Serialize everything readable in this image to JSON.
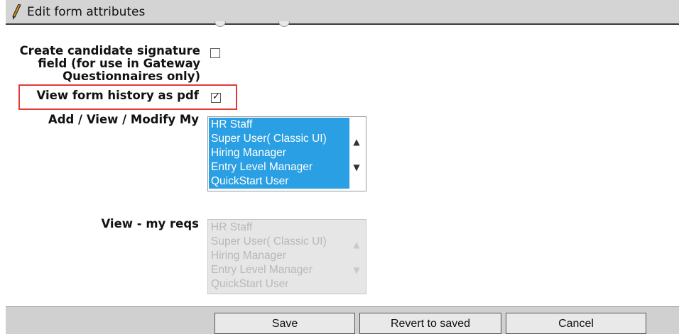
{
  "header": {
    "title": "Edit form attributes",
    "icon": "pencil-icon"
  },
  "fields": {
    "signature": {
      "label_line1": "Create candidate signature",
      "label_line2": "field (for use in Gateway",
      "label_line3": "Questionnaires only)",
      "checked": false
    },
    "history_pdf": {
      "label": "View form history as pdf",
      "checked": true
    },
    "add_view_modify": {
      "label": "Add / View / Modify My",
      "options": [
        "HR Staff",
        "Super User( Classic UI)",
        "Hiring Manager",
        "Entry Level Manager",
        "QuickStart User"
      ],
      "selected": [
        "HR Staff",
        "Super User( Classic UI)",
        "Hiring Manager",
        "Entry Level Manager",
        "QuickStart User"
      ],
      "enabled": true
    },
    "view_my_reqs": {
      "label": "View - my reqs",
      "options": [
        "HR Staff",
        "Super User( Classic UI)",
        "Hiring Manager",
        "Entry Level Manager",
        "QuickStart User"
      ],
      "enabled": false
    }
  },
  "footer": {
    "save": "Save",
    "revert": "Revert to saved",
    "cancel": "Cancel"
  },
  "colors": {
    "selection": "#2a9fe3",
    "highlight_border": "#e53935"
  }
}
